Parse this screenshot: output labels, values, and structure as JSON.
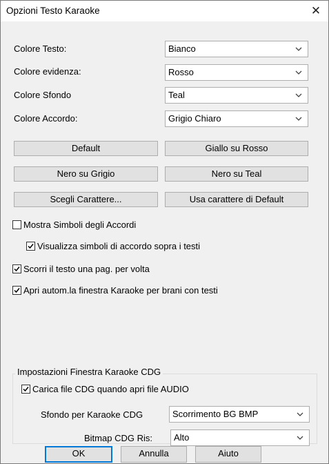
{
  "window": {
    "title": "Opzioni Testo Karaoke",
    "close_glyph": "✕"
  },
  "colors": {
    "label_text": "Colore Testo:",
    "text_value": "Bianco",
    "highlight_label": "Colore evidenza:",
    "highlight_value": "Rosso",
    "background_label": "Colore Sfondo",
    "background_value": "Teal",
    "chord_label": "Colore Accordo:",
    "chord_value": "Grigio Chiaro"
  },
  "presets": {
    "default": "Default",
    "yellow_on_red": "Giallo su Rosso",
    "black_on_gray": "Nero su Grigio",
    "black_on_teal": "Nero su Teal",
    "choose_font": "Scegli Carattere...",
    "use_default_font": "Usa carattere di Default"
  },
  "options": {
    "show_chords": {
      "label": "Mostra Simboli degli Accordi",
      "checked": false
    },
    "show_chords_above": {
      "label": "Visualizza simboli di accordo sopra i testi",
      "checked": true
    },
    "scroll_page": {
      "label": "Scorri il testo una pag. per volta",
      "checked": true
    },
    "auto_open": {
      "label": "Apri autom.la finestra Karaoke per brani con testi",
      "checked": true
    }
  },
  "cdg": {
    "group_title": "Impostazioni Finestra Karaoke CDG",
    "load_cdg": {
      "label": "Carica file CDG quando apri file AUDIO",
      "checked": true
    },
    "background_label": "Sfondo per Karaoke CDG",
    "background_value": "Scorrimento BG BMP",
    "resolution_label": "Bitmap CDG Ris:",
    "resolution_value": "Alto"
  },
  "footer": {
    "ok": "OK",
    "cancel": "Annulla",
    "help": "Aiuto"
  },
  "theme": {
    "window_bg": "#f0f0f0",
    "button_bg": "#e1e1e1",
    "default_button_border": "#0078d7"
  }
}
